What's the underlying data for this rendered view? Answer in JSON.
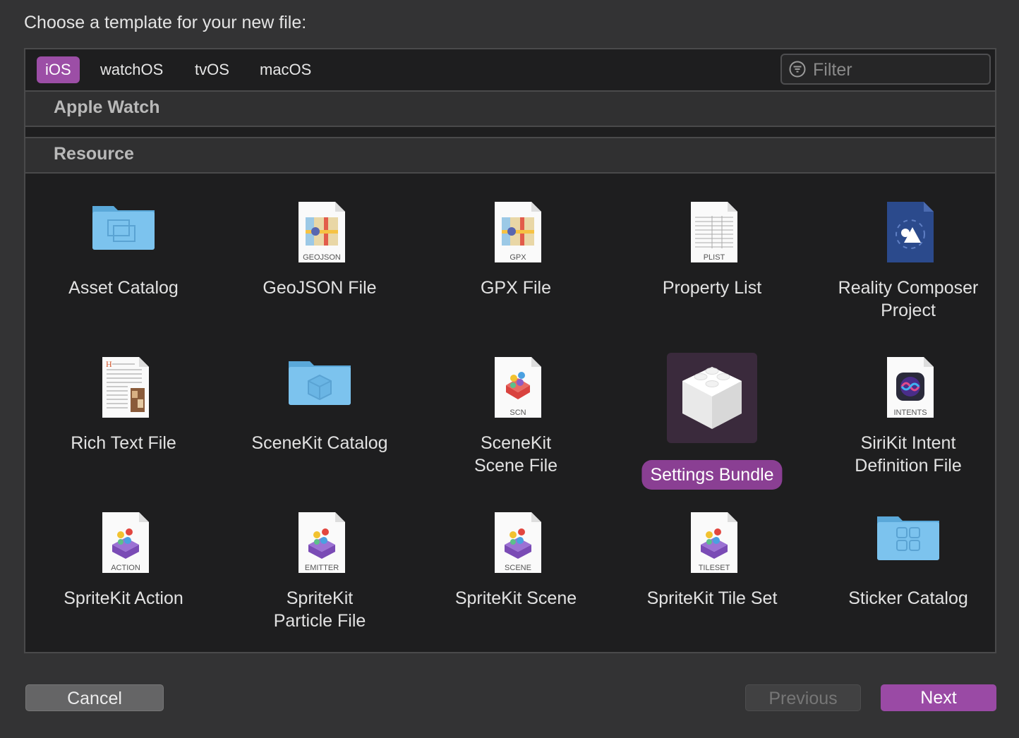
{
  "prompt": "Choose a template for your new file:",
  "tabs": [
    {
      "label": "iOS",
      "active": true
    },
    {
      "label": "watchOS",
      "active": false
    },
    {
      "label": "tvOS",
      "active": false
    },
    {
      "label": "macOS",
      "active": false
    }
  ],
  "filter": {
    "placeholder": "Filter"
  },
  "sections": [
    "Apple Watch",
    "Resource"
  ],
  "items": [
    {
      "label": "Asset Catalog",
      "icon": "folder-icon"
    },
    {
      "label": "GeoJSON File",
      "icon": "map-document-icon",
      "tag": "GEOJSON"
    },
    {
      "label": "GPX File",
      "icon": "map-document-icon",
      "tag": "GPX"
    },
    {
      "label": "Property List",
      "icon": "table-document-icon",
      "tag": "PLIST"
    },
    {
      "label": "Reality Composer Project",
      "icon": "reality-composer-icon"
    },
    {
      "label": "Rich Text File",
      "icon": "rich-text-document-icon"
    },
    {
      "label": "SceneKit Catalog",
      "icon": "folder-cube-icon"
    },
    {
      "label": "SceneKit Scene File",
      "icon": "scenekit-document-icon",
      "tag": "SCN"
    },
    {
      "label": "Settings Bundle",
      "icon": "lego-brick-icon",
      "selected": true
    },
    {
      "label": "SiriKit Intent Definition File",
      "icon": "siri-document-icon",
      "tag": "INTENTS"
    },
    {
      "label": "SpriteKit Action",
      "icon": "spritekit-document-icon",
      "tag": "ACTION"
    },
    {
      "label": "SpriteKit Particle File",
      "icon": "spritekit-document-icon",
      "tag": "EMITTER"
    },
    {
      "label": "SpriteKit Scene",
      "icon": "spritekit-document-icon",
      "tag": "SCENE"
    },
    {
      "label": "SpriteKit Tile Set",
      "icon": "spritekit-document-icon",
      "tag": "TILESET"
    },
    {
      "label": "Sticker Catalog",
      "icon": "sticker-folder-icon"
    }
  ],
  "buttons": {
    "cancel": "Cancel",
    "previous": "Previous",
    "next": "Next"
  },
  "colors": {
    "accent": "#9a4aa5",
    "background": "#333334",
    "panel": "#1e1e1f"
  }
}
